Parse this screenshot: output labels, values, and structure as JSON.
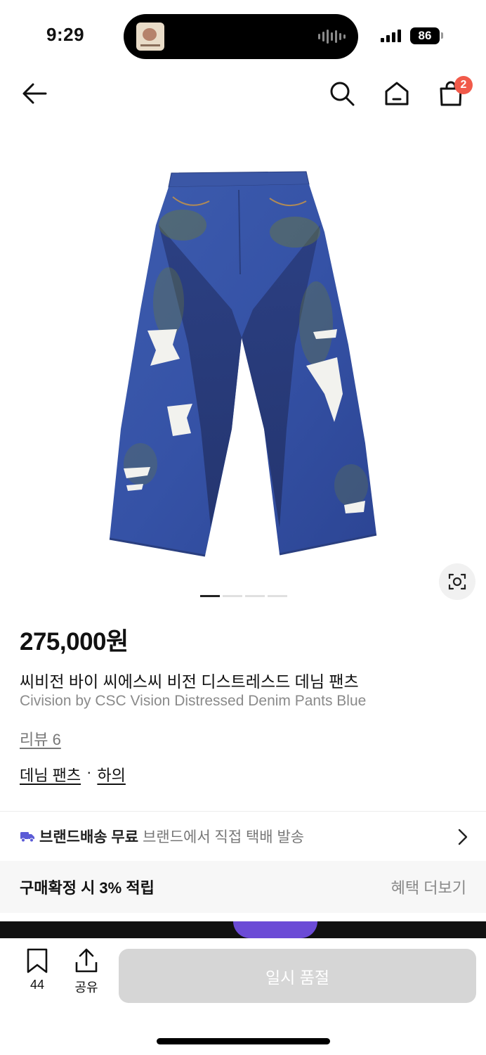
{
  "status": {
    "time": "9:29",
    "battery": "86"
  },
  "nav": {
    "cart_count": "2"
  },
  "product": {
    "price": "275,000원",
    "name_ko": "씨비전 바이 씨에스씨 비전 디스트레스드 데님 팬츠",
    "name_en": "Civision by CSC Vision Distressed Denim Pants Blue",
    "review": "리뷰 6",
    "category": "데님 팬츠",
    "category_sep": "·",
    "category_parent": "하의",
    "image_icon": "denim-pants-photo",
    "carousel_total": 4,
    "carousel_active": 1
  },
  "shipping": {
    "title": "브랜드배송 무료",
    "desc": "브랜드에서 직접 택배 발송"
  },
  "points": {
    "text": "구매확정 시 3% 적립",
    "more": "혜택 더보기"
  },
  "bottom": {
    "wish_count": "44",
    "share_label": "공유",
    "buy_label": "일시 품절"
  },
  "colors": {
    "accent_badge": "#f15a4a",
    "shipping_truck": "#5b5bd6",
    "disabled_button": "#d6d6d6"
  }
}
